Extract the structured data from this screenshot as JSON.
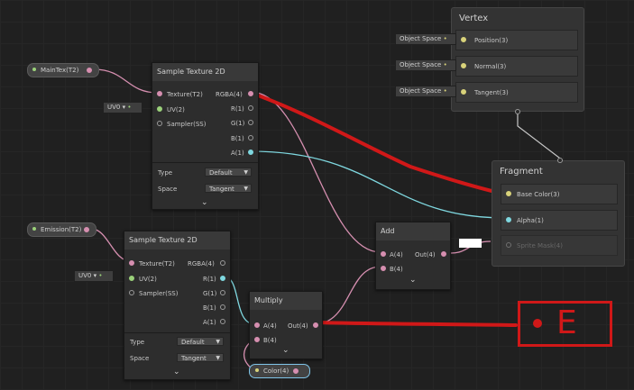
{
  "main_tex": {
    "label": "MainTex(T2)"
  },
  "emission": {
    "label": "Emission(T2)"
  },
  "color_prop": {
    "label": "Color(4)"
  },
  "sample1": {
    "title": "Sample Texture 2D",
    "inputs": [
      "Texture(T2)",
      "UV(2)",
      "Sampler(SS)"
    ],
    "outputs": [
      "RGBA(4)",
      "R(1)",
      "G(1)",
      "B(1)",
      "A(1)"
    ],
    "uv_value": "UV0",
    "type_label": "Type",
    "type_value": "Default",
    "space_label": "Space",
    "space_value": "Tangent"
  },
  "sample2": {
    "title": "Sample Texture 2D",
    "inputs": [
      "Texture(T2)",
      "UV(2)",
      "Sampler(SS)"
    ],
    "outputs": [
      "RGBA(4)",
      "R(1)",
      "G(1)",
      "B(1)",
      "A(1)"
    ],
    "uv_value": "UV0",
    "type_label": "Type",
    "type_value": "Default",
    "space_label": "Space",
    "space_value": "Tangent"
  },
  "multiply": {
    "title": "Multiply",
    "inputs": [
      "A(4)",
      "B(4)"
    ],
    "output": "Out(4)"
  },
  "add": {
    "title": "Add",
    "inputs": [
      "A(4)",
      "B(4)"
    ],
    "output": "Out(4)"
  },
  "vertex": {
    "title": "Vertex",
    "slots": [
      "Position(3)",
      "Normal(3)",
      "Tangent(3)"
    ],
    "values": [
      "Object Space",
      "Object Space",
      "Object Space"
    ]
  },
  "fragment": {
    "title": "Fragment",
    "slots": [
      "Base Color(3)",
      "Alpha(1)",
      "Sprite Mask(4)"
    ]
  },
  "annotation": {
    "text": "E"
  },
  "colors": {
    "wire_pink": "#d68fb0",
    "wire_cyan": "#7fd8e0",
    "wire_gray": "#c8c8c8",
    "annotation_red": "#d01818"
  }
}
